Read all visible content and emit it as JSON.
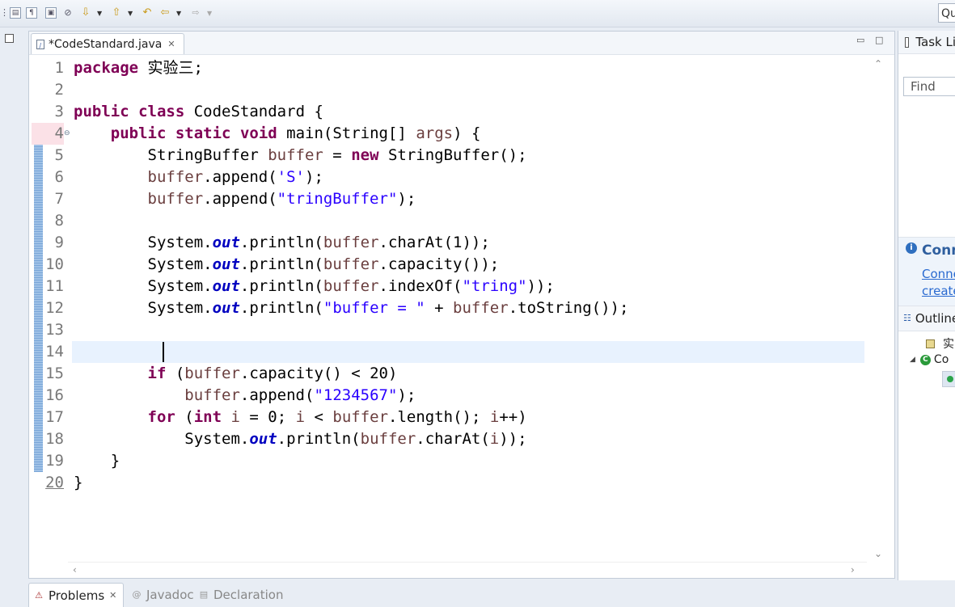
{
  "toolbar": {
    "quick_access": "Qu"
  },
  "editor": {
    "tab_label": "*CodeStandard.java",
    "tab_close": "✕",
    "file_icon": "J",
    "minimize": "▭",
    "maximize": "□"
  },
  "code": {
    "current_line": 4,
    "caret_line": 14,
    "changed_lines": [
      4,
      5,
      6,
      7,
      8,
      9,
      10,
      11,
      12,
      13,
      14,
      15,
      16,
      17,
      18,
      19
    ],
    "lines": [
      [
        {
          "t": "package",
          "c": "kw"
        },
        {
          "t": " 实验三;"
        }
      ],
      [],
      [
        {
          "t": "public",
          "c": "kw"
        },
        {
          "t": " "
        },
        {
          "t": "class",
          "c": "kw"
        },
        {
          "t": " CodeStandard {"
        }
      ],
      [
        {
          "t": "    "
        },
        {
          "t": "public",
          "c": "kw"
        },
        {
          "t": " "
        },
        {
          "t": "static",
          "c": "kw"
        },
        {
          "t": " "
        },
        {
          "t": "void",
          "c": "kw"
        },
        {
          "t": " main(String[] "
        },
        {
          "t": "args",
          "c": "var"
        },
        {
          "t": ") {"
        }
      ],
      [
        {
          "t": "        StringBuffer "
        },
        {
          "t": "buffer",
          "c": "var"
        },
        {
          "t": " = "
        },
        {
          "t": "new",
          "c": "kw"
        },
        {
          "t": " StringBuffer();"
        }
      ],
      [
        {
          "t": "        "
        },
        {
          "t": "buffer",
          "c": "var"
        },
        {
          "t": ".append("
        },
        {
          "t": "'S'",
          "c": "str"
        },
        {
          "t": ");"
        }
      ],
      [
        {
          "t": "        "
        },
        {
          "t": "buffer",
          "c": "var"
        },
        {
          "t": ".append("
        },
        {
          "t": "\"tringBuffer\"",
          "c": "str"
        },
        {
          "t": ");"
        }
      ],
      [],
      [
        {
          "t": "        System."
        },
        {
          "t": "out",
          "c": "fld"
        },
        {
          "t": ".println("
        },
        {
          "t": "buffer",
          "c": "var"
        },
        {
          "t": ".charAt(1));"
        }
      ],
      [
        {
          "t": "        System."
        },
        {
          "t": "out",
          "c": "fld"
        },
        {
          "t": ".println("
        },
        {
          "t": "buffer",
          "c": "var"
        },
        {
          "t": ".capacity());"
        }
      ],
      [
        {
          "t": "        System."
        },
        {
          "t": "out",
          "c": "fld"
        },
        {
          "t": ".println("
        },
        {
          "t": "buffer",
          "c": "var"
        },
        {
          "t": ".indexOf("
        },
        {
          "t": "\"tring\"",
          "c": "str"
        },
        {
          "t": "));"
        }
      ],
      [
        {
          "t": "        System."
        },
        {
          "t": "out",
          "c": "fld"
        },
        {
          "t": ".println("
        },
        {
          "t": "\"buffer = \"",
          "c": "str"
        },
        {
          "t": " + "
        },
        {
          "t": "buffer",
          "c": "var"
        },
        {
          "t": ".toString());"
        }
      ],
      [],
      [],
      [
        {
          "t": "        "
        },
        {
          "t": "if",
          "c": "kw"
        },
        {
          "t": " ("
        },
        {
          "t": "buffer",
          "c": "var"
        },
        {
          "t": ".capacity() < 20)"
        }
      ],
      [
        {
          "t": "            "
        },
        {
          "t": "buffer",
          "c": "var"
        },
        {
          "t": ".append("
        },
        {
          "t": "\"1234567\"",
          "c": "str"
        },
        {
          "t": ");"
        }
      ],
      [
        {
          "t": "        "
        },
        {
          "t": "for",
          "c": "kw"
        },
        {
          "t": " ("
        },
        {
          "t": "int",
          "c": "kw"
        },
        {
          "t": " "
        },
        {
          "t": "i",
          "c": "var"
        },
        {
          "t": " = 0; "
        },
        {
          "t": "i",
          "c": "var"
        },
        {
          "t": " < "
        },
        {
          "t": "buffer",
          "c": "var"
        },
        {
          "t": ".length(); "
        },
        {
          "t": "i",
          "c": "var"
        },
        {
          "t": "++)"
        }
      ],
      [
        {
          "t": "            System."
        },
        {
          "t": "out",
          "c": "fld"
        },
        {
          "t": ".println("
        },
        {
          "t": "buffer",
          "c": "var"
        },
        {
          "t": ".charAt("
        },
        {
          "t": "i",
          "c": "var"
        },
        {
          "t": "));"
        }
      ],
      [
        {
          "t": "    }"
        }
      ],
      [
        {
          "t": "}"
        }
      ]
    ]
  },
  "right_panel": {
    "task_list_label": "Task Li",
    "find_placeholder": "Find",
    "connect_title": "Conn",
    "connect_link1": "Conne",
    "connect_link2": "create",
    "outline_label": "Outline",
    "outline_items": [
      "实",
      "Co"
    ]
  },
  "bottom": {
    "problems": "Problems",
    "problems_close": "✕",
    "javadoc": "Javadoc",
    "declaration": "Declaration"
  }
}
